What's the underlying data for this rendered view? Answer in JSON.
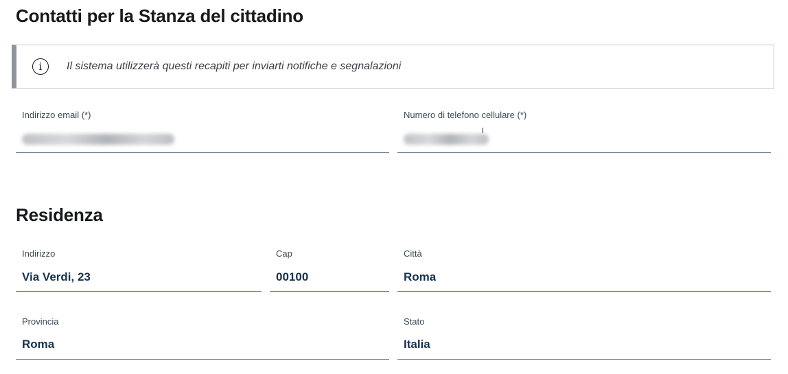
{
  "contacts": {
    "title": "Contatti per la Stanza del cittadino",
    "info_icon": "info-circle-icon",
    "info_text": "Il sistema utilizzerà questi recapiti per inviarti notifiche e segnalazioni",
    "email": {
      "label": "Indirizzo email (*)",
      "value": ""
    },
    "phone": {
      "label": "Numero di telefono cellulare (*)",
      "value": ""
    }
  },
  "residence": {
    "title": "Residenza",
    "address": {
      "label": "Indirizzo",
      "value": "Via Verdi, 23"
    },
    "cap": {
      "label": "Cap",
      "value": "00100"
    },
    "city": {
      "label": "Città",
      "value": "Roma"
    },
    "province": {
      "label": "Provincia",
      "value": "Roma"
    },
    "state": {
      "label": "Stato",
      "value": "Italia"
    }
  },
  "colors": {
    "title": "#17191c",
    "value_text": "#17324d",
    "field_underline": "#5c6f82",
    "callout_border": "#8f9499"
  }
}
